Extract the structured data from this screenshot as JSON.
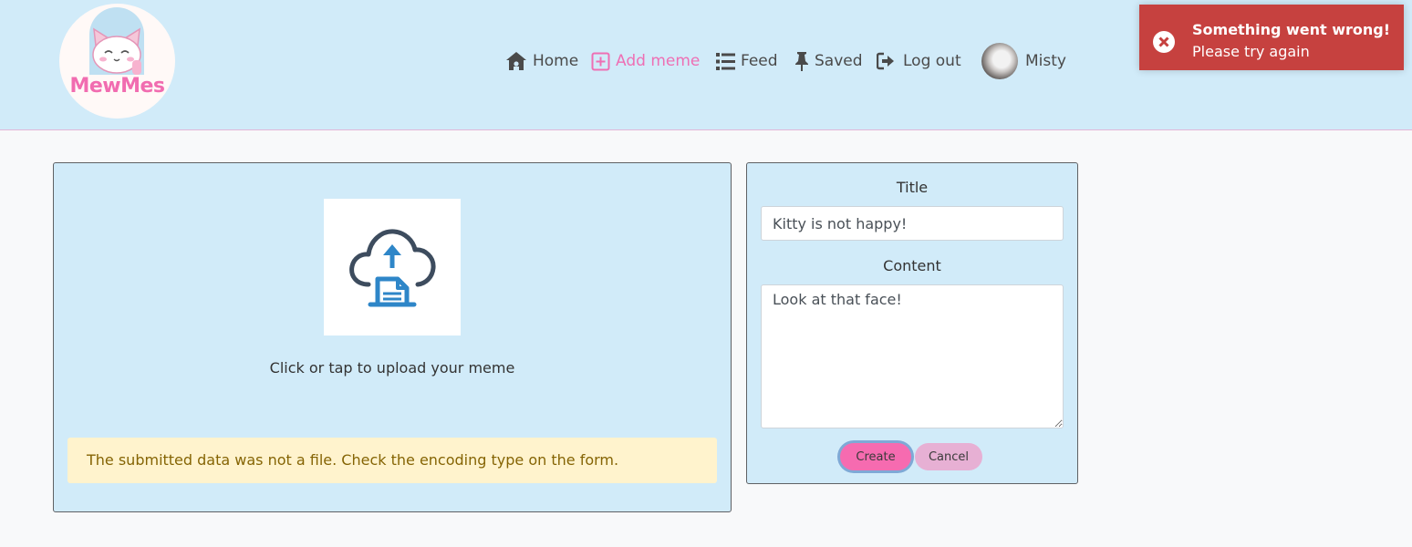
{
  "brand": {
    "name": "MewMes"
  },
  "nav": {
    "home": "Home",
    "add_meme": "Add meme",
    "feed": "Feed",
    "saved": "Saved",
    "logout": "Log out",
    "user": "Misty"
  },
  "toast": {
    "title": "Something went wrong!",
    "message": "Please try again"
  },
  "upload": {
    "prompt": "Click or tap to upload your meme",
    "error": "The submitted data was not a file. Check the encoding type on the form."
  },
  "form": {
    "title_label": "Title",
    "title_value": "Kitty is not happy!",
    "content_label": "Content",
    "content_value": "Look at that face!",
    "create_label": "Create",
    "cancel_label": "Cancel"
  },
  "colors": {
    "navbar_bg": "#d1ebf9",
    "accent_pink": "#ee6fb4",
    "toast_bg": "#c6413f",
    "alert_bg": "#fff3cd",
    "alert_text": "#856404",
    "upload_icon_dark": "#3d4c5e",
    "upload_icon_blue": "#2e86c8"
  },
  "icons": {
    "home": "home-icon",
    "add": "plus-square-icon",
    "feed": "list-icon",
    "saved": "thumbtack-icon",
    "logout": "sign-out-icon",
    "toast": "times-circle-icon",
    "upload": "cloud-upload-file-icon"
  }
}
